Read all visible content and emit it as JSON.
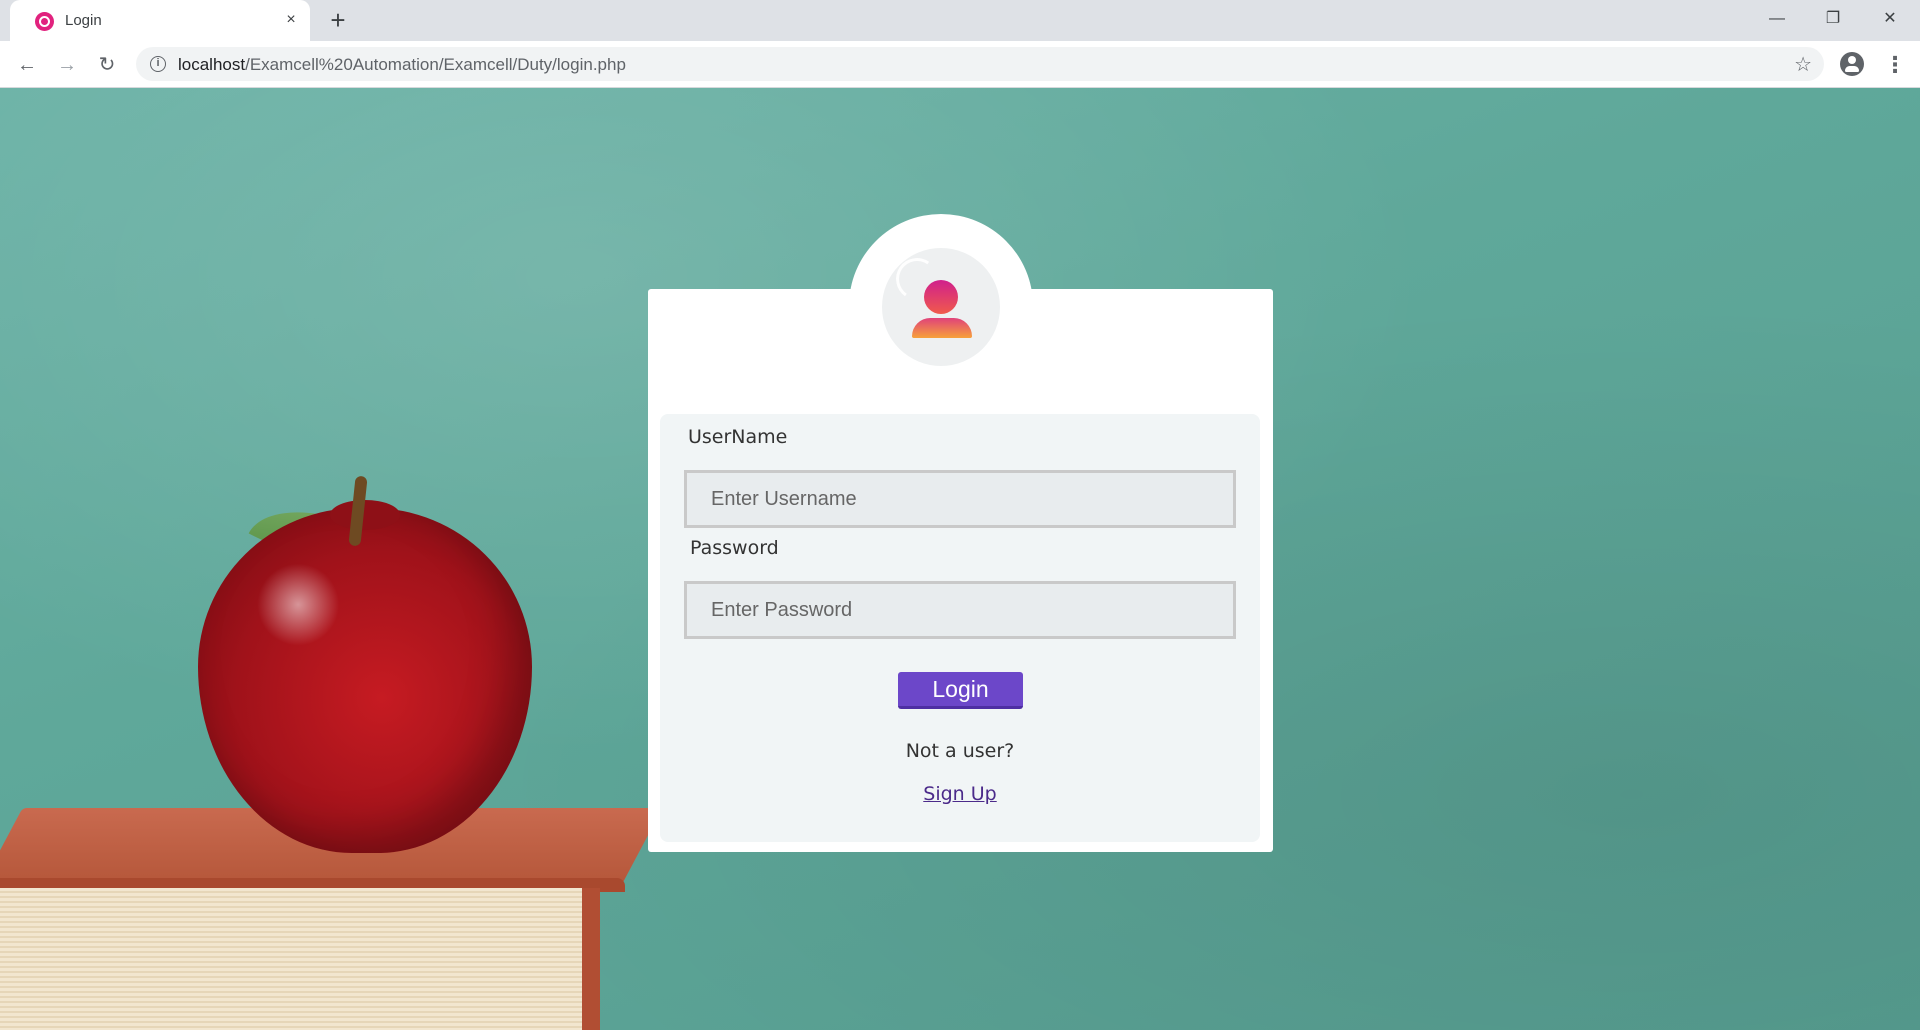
{
  "browser": {
    "tab": {
      "title": "Login",
      "favicon": "wamp-icon",
      "close_symbol": "×"
    },
    "new_tab_symbol": "+",
    "window_controls": {
      "minimize": "—",
      "restore": "❐",
      "close": "✕"
    },
    "nav": {
      "back": "←",
      "forward": "→",
      "reload": "↻"
    },
    "address_bar": {
      "host": "localhost",
      "path": "/Examcell%20Automation/Examcell/Duty/login.php",
      "info_symbol": "i",
      "star_symbol": "☆"
    },
    "menu_symbol": "⋮"
  },
  "login": {
    "avatar": "user-avatar-icon",
    "username_label": "UserName",
    "username_placeholder": "Enter Username",
    "username_value": "",
    "password_label": "Password",
    "password_placeholder": "Enter Password",
    "password_value": "",
    "login_button": "Login",
    "not_user_text": "Not a user?",
    "signup_link": "Sign Up"
  },
  "colors": {
    "background": "#5fa89a",
    "button": "#6c47c9",
    "link": "#4b2a8a",
    "avatar_gradient_top": "#d0208c",
    "avatar_gradient_bottom": "#f7a13a"
  }
}
